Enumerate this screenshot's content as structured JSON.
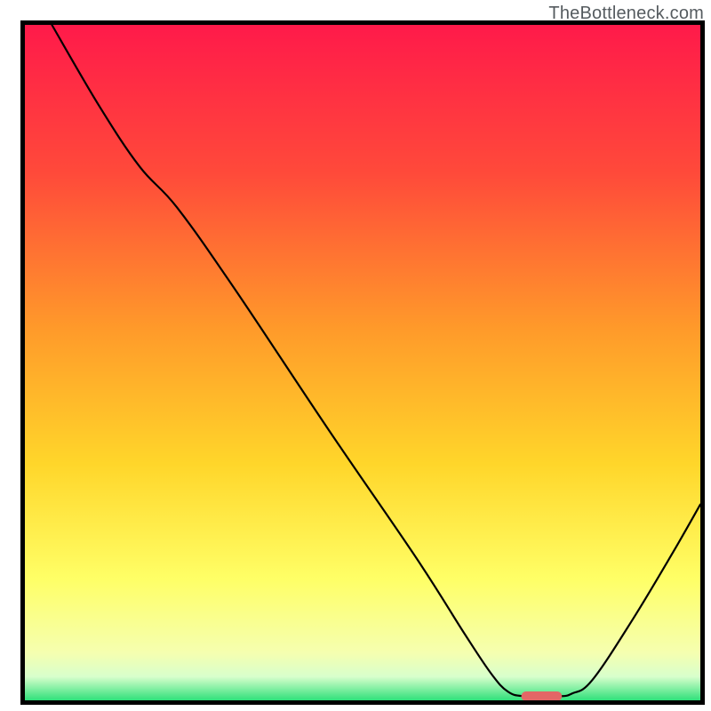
{
  "watermark": "TheBottleneck.com",
  "chart_data": {
    "type": "line",
    "title": "",
    "xlabel": "",
    "ylabel": "",
    "xlim": [
      0,
      100
    ],
    "ylim": [
      0,
      100
    ],
    "gradient_stops": [
      {
        "offset": 0,
        "color": "#ff1a4a"
      },
      {
        "offset": 0.22,
        "color": "#ff4a3a"
      },
      {
        "offset": 0.45,
        "color": "#ff9a2a"
      },
      {
        "offset": 0.65,
        "color": "#ffd62a"
      },
      {
        "offset": 0.82,
        "color": "#ffff66"
      },
      {
        "offset": 0.93,
        "color": "#f5ffb0"
      },
      {
        "offset": 0.965,
        "color": "#d8ffcc"
      },
      {
        "offset": 1.0,
        "color": "#2fe07a"
      }
    ],
    "series": [
      {
        "name": "curve",
        "points": [
          {
            "x": 4.0,
            "y": 100.0
          },
          {
            "x": 11.0,
            "y": 88.0
          },
          {
            "x": 17.0,
            "y": 79.0
          },
          {
            "x": 22.5,
            "y": 73.0
          },
          {
            "x": 31.0,
            "y": 61.0
          },
          {
            "x": 45.0,
            "y": 40.0
          },
          {
            "x": 58.0,
            "y": 21.0
          },
          {
            "x": 65.0,
            "y": 10.0
          },
          {
            "x": 69.0,
            "y": 4.0
          },
          {
            "x": 71.5,
            "y": 1.3
          },
          {
            "x": 74.0,
            "y": 0.6
          },
          {
            "x": 79.0,
            "y": 0.6
          },
          {
            "x": 81.0,
            "y": 1.0
          },
          {
            "x": 84.0,
            "y": 3.0
          },
          {
            "x": 90.0,
            "y": 12.0
          },
          {
            "x": 96.0,
            "y": 22.0
          },
          {
            "x": 100.0,
            "y": 29.0
          }
        ]
      }
    ],
    "marker": {
      "x_start": 73.5,
      "x_end": 79.5,
      "y": 0.6,
      "color": "#e36666"
    },
    "frame_line_width": 5,
    "curve_line_width": 2.2
  }
}
